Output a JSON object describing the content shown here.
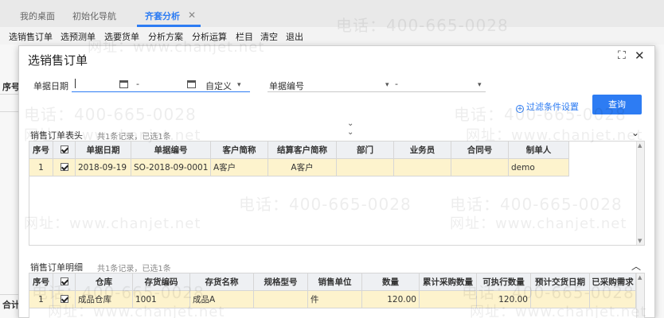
{
  "app_tabs": [
    {
      "label": "我的桌面"
    },
    {
      "label": "初始化导航"
    },
    {
      "label": "齐套分析",
      "active": true
    }
  ],
  "toolbar": [
    "选销售订单",
    "选预测单",
    "选要货单",
    "分析方案",
    "分析运算",
    "栏目",
    "清空",
    "退出"
  ],
  "background": {
    "col_label": "序号",
    "footer_label": "合计"
  },
  "modal": {
    "title": "选销售订单",
    "maximize_icon": "maximize-icon",
    "close_icon": "close-icon",
    "filters": {
      "date_label": "单据日期",
      "date_separator": "-",
      "date_mode": "自定义",
      "code_label": "单据编号",
      "code_separator": "-"
    },
    "filter_settings_link": "过滤条件设置",
    "query_button": "查询",
    "header_section": {
      "title": "销售订单表头",
      "summary": "共1条记录，已选1条",
      "columns": [
        "序号",
        "",
        "单据日期",
        "单据编号",
        "客户简称",
        "结算客户简称",
        "部门",
        "业务员",
        "合同号",
        "制单人"
      ],
      "rows": [
        {
          "no": "1",
          "checked": true,
          "date": "2018-09-19",
          "code": "SO-2018-09-0001",
          "customer": "A客户",
          "settle_customer": "A客户",
          "dept": "",
          "salesman": "",
          "contract": "",
          "maker": "demo"
        }
      ]
    },
    "detail_section": {
      "title": "销售订单明细",
      "summary": "共1条记录，已选1条",
      "columns": [
        "序号",
        "",
        "仓库",
        "存货编码",
        "存货名称",
        "规格型号",
        "销售单位",
        "数量",
        "累计采购数量",
        "可执行数量",
        "预计交货日期",
        "已采购需求"
      ],
      "rows": [
        {
          "no": "1",
          "checked": true,
          "warehouse": "成品仓库",
          "item_code": "1001",
          "item_name": "成品A",
          "spec": "",
          "unit": "件",
          "qty": "120.00",
          "purchased": "",
          "executable": "120.00",
          "delivery_date": "",
          "purchased_demand": ""
        }
      ]
    }
  },
  "watermark": {
    "phone": "电话：400-665-0028",
    "site": "网址：www.chanjet.net"
  },
  "colors": {
    "accent": "#2d7cf3",
    "selected_row": "#fdf3cd",
    "header_bg": "#eef0f3"
  }
}
